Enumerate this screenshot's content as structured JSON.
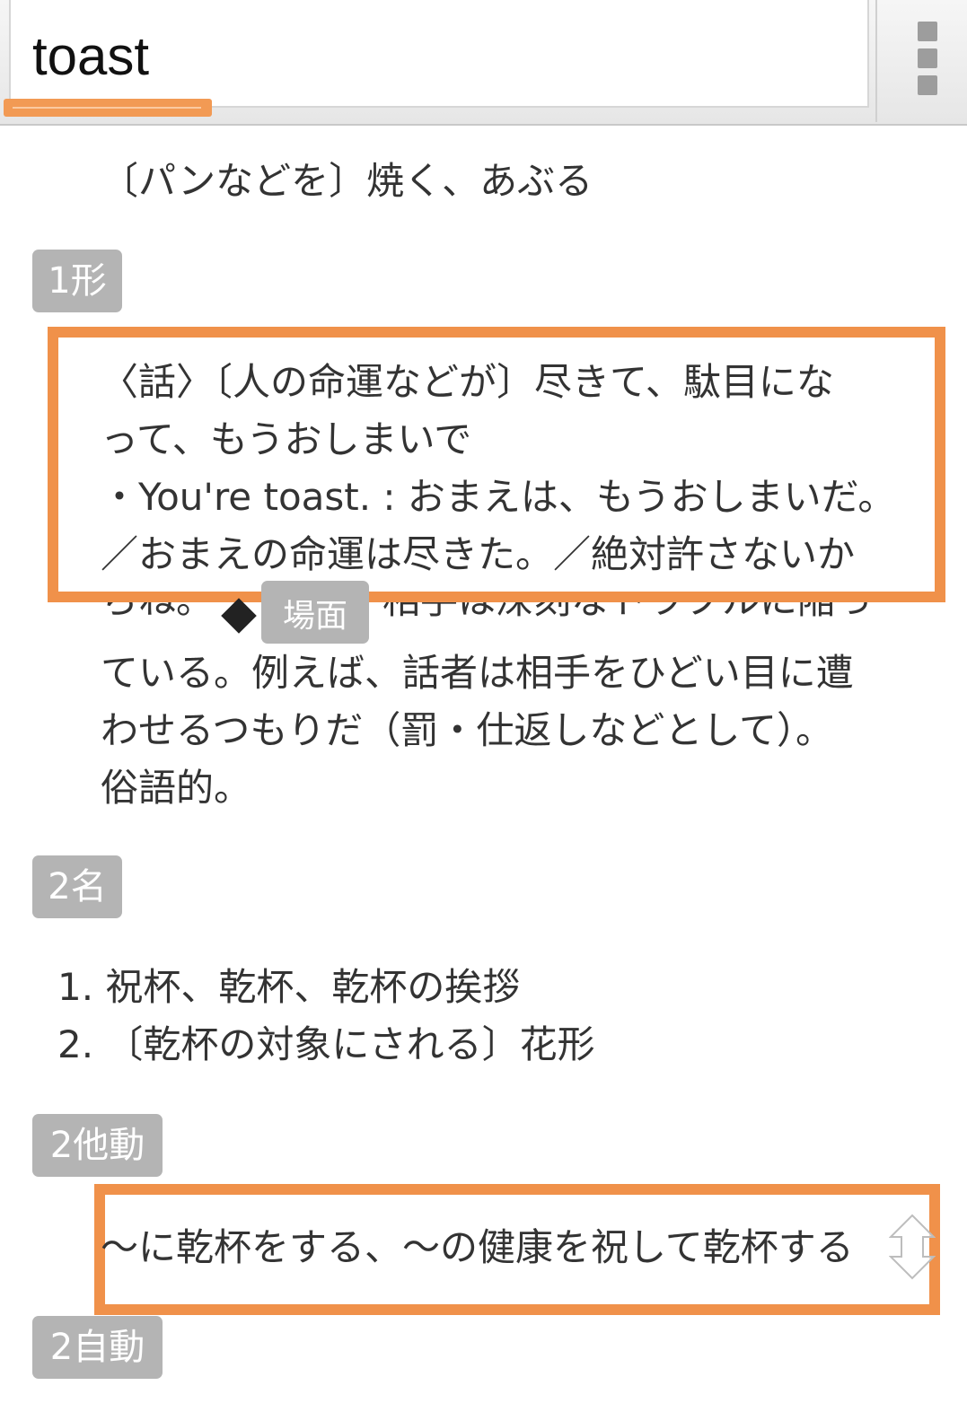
{
  "search": {
    "value": "toast"
  },
  "entry": {
    "verb_def": "〔パンなどを〕焼く、あぶる",
    "adj": {
      "badge": "1形",
      "lines": [
        "〈話〉〔人の命運などが〕尽きて、駄目にな",
        "って、もうおしまいで",
        "・You're toast. : おまえは、もうおしまいだ。",
        "／おまえの命運は尽きた。／絶対許さないか",
        "らね。",
        "相手は深刻なトラブルに陥っ",
        "ている。例えば、話者は相手をひどい目に遭",
        "わせるつもりだ（罰・仕返しなどとして）。",
        "俗語的。"
      ],
      "scene_badge": "場面"
    },
    "noun": {
      "badge": "2名",
      "items": [
        "1. 祝杯、乾杯、乾杯の挨拶",
        "2. 〔乾杯の対象にされる〕花形"
      ]
    },
    "transitive": {
      "badge": "2他動",
      "def": "～に乾杯をする、～の健康を祝して乾杯する"
    },
    "intransitive": {
      "badge": "2自動"
    }
  },
  "colors": {
    "highlight": "#f0914a",
    "badge_bg": "#b4b4b4"
  },
  "icons": {
    "menu": "vertical-dots-icon",
    "scroll": "double-arrow-icon"
  }
}
